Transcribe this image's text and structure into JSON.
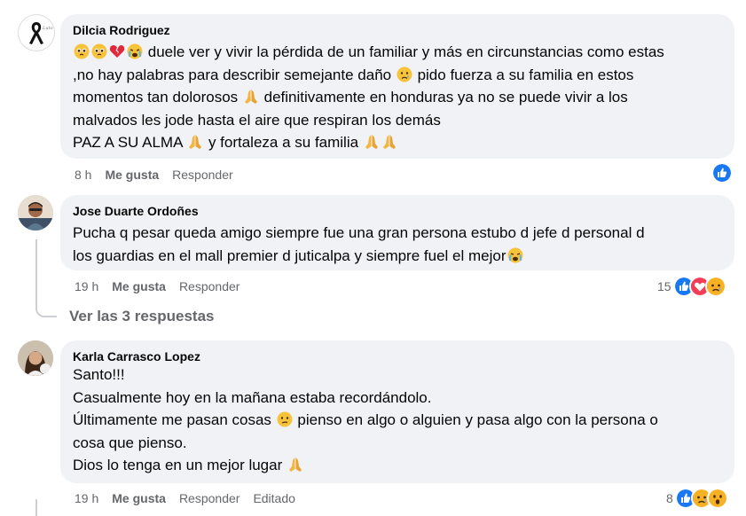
{
  "comments": [
    {
      "author": "Dilcia Rodriguez",
      "lines": [
        "duele ver y vivir la pérdida de un familiar y más en circunstancias como estas",
        ",no hay palabras para describir semejante daño",
        "pido fuerza a su familia en estos",
        "momentos tan dolorosos",
        "definitivamente en honduras ya no se puede vivir a los",
        "malvados les jode hasta el aire que respiran los demás",
        "PAZ A SU ALMA",
        "y fortaleza a su familia"
      ],
      "time": "8 h",
      "like_label": "Me gusta",
      "reply_label": "Responder"
    },
    {
      "author": "Jose Duarte Ordoñes",
      "lines": [
        "Pucha q pesar queda amigo siempre fue una gran persona estubo d jefe d personal d",
        "los guardias en el mall premier d juticalpa y siempre fuel el mejor"
      ],
      "time": "19 h",
      "like_label": "Me gusta",
      "reply_label": "Responder",
      "reaction_count": "15"
    },
    {
      "author": "Karla Carrasco Lopez",
      "lines": [
        "Santo!!!",
        "Casualmente hoy en la mañana estaba recordándolo.",
        "Últimamente me pasan cosas",
        "pienso en algo o alguien y pasa algo con la persona o",
        "cosa que pienso.",
        "Dios lo tenga en un mejor lugar"
      ],
      "time": "19 h",
      "like_label": "Me gusta",
      "reply_label": "Responder",
      "edited_label": "Editado",
      "reaction_count": "8"
    }
  ],
  "view_replies": "Ver las 3 respuestas",
  "colors": {
    "like_blue": "#1877f2",
    "love_red": "#f33e58",
    "emoji_yellow": "#f7b125",
    "meta_gray": "#65676b",
    "bubble_bg": "#f0f2f5"
  },
  "icons": [
    "like-reaction-icon",
    "love-reaction-icon",
    "sad-reaction-icon",
    "wow-reaction-icon",
    "pleading-face-icon",
    "broken-heart-icon",
    "crying-face-icon",
    "sad-tear-face-icon",
    "praying-hands-icon",
    "confused-face-icon"
  ]
}
